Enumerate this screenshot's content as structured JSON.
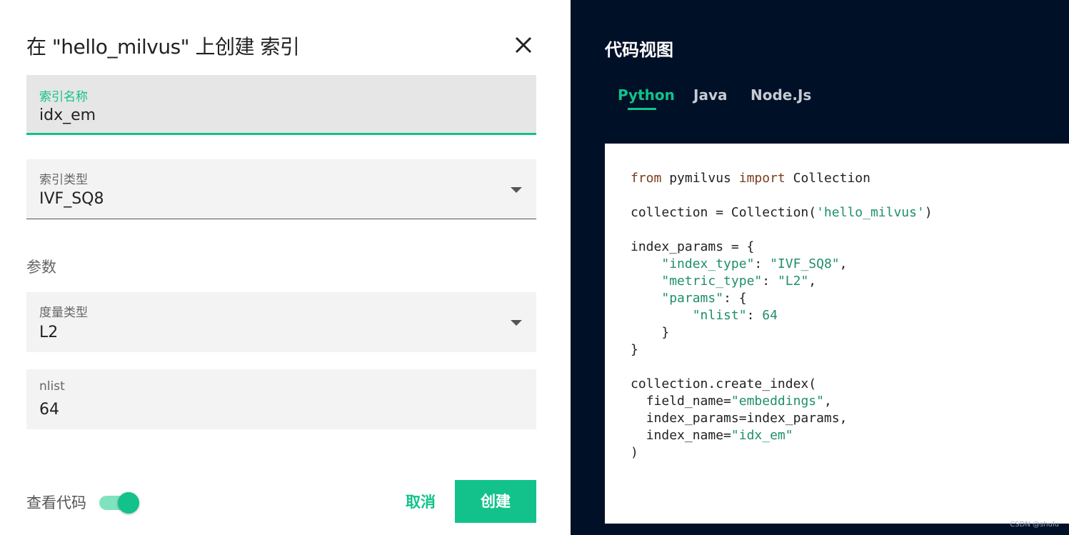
{
  "dialog": {
    "title": "在 \"hello_milvus\" 上创建 索引",
    "index_name": {
      "label": "索引名称",
      "value": "idx_em"
    },
    "index_type": {
      "label": "索引类型",
      "value": "IVF_SQ8"
    },
    "params_heading": "参数",
    "metric_type": {
      "label": "度量类型",
      "value": "L2"
    },
    "nlist": {
      "label": "nlist",
      "value": "64"
    },
    "view_code_label": "查看代码",
    "view_code_enabled": true,
    "cancel_label": "取消",
    "create_label": "创建"
  },
  "code_panel": {
    "title": "代码视图",
    "tabs": [
      {
        "label": "Python",
        "active": true
      },
      {
        "label": "Java",
        "active": false
      },
      {
        "label": "Node.Js",
        "active": false
      }
    ],
    "code": {
      "l1_kw1": "from",
      "l1_mid": " pymilvus ",
      "l1_kw2": "import",
      "l1_end": " Collection",
      "l3_a": "collection = Collection(",
      "l3_str": "'hello_milvus'",
      "l3_b": ")",
      "l5": "index_params = {",
      "l6_str": "\"index_type\"",
      "l6_mid": ": ",
      "l6_val": "\"IVF_SQ8\"",
      "l6_end": ",",
      "l7_str": "\"metric_type\"",
      "l7_mid": ": ",
      "l7_val": "\"L2\"",
      "l7_end": ",",
      "l8_str": "\"params\"",
      "l8_end": ": {",
      "l9_str": "\"nlist\"",
      "l9_mid": ": ",
      "l9_num": "64",
      "l10": "}",
      "l11": "}",
      "l13": "collection.create_index(",
      "l14_a": "field_name=",
      "l14_str": "\"embeddings\"",
      "l14_b": ",",
      "l15": "index_params=index_params,",
      "l16_a": "index_name=",
      "l16_str": "\"idx_em\"",
      "l17": ")"
    },
    "watermark": "CSDN @shulu"
  },
  "colors": {
    "accent": "#12c28a",
    "panel_bg": "#001027"
  }
}
